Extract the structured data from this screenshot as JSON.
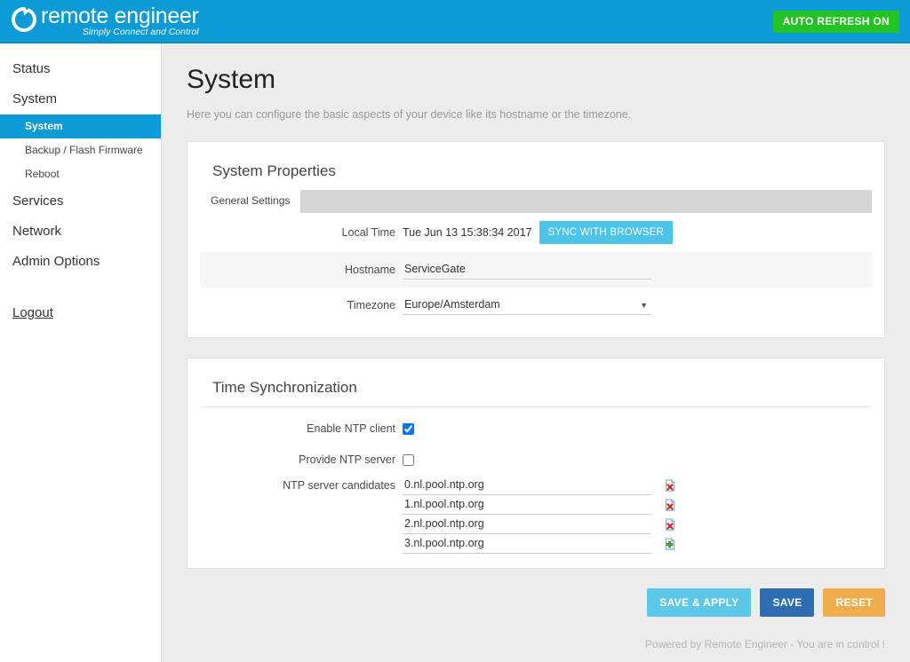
{
  "header": {
    "logo_title": "remote engineer",
    "logo_tagline": "Simply Connect and Control",
    "auto_refresh_label": "AUTO REFRESH ON",
    "bg_color": "#0c9bd4",
    "auto_refresh_color": "#22c322"
  },
  "sidebar": {
    "items": [
      {
        "label": "Status"
      },
      {
        "label": "System"
      }
    ],
    "sub_items": [
      {
        "label": "System",
        "active": true
      },
      {
        "label": "Backup / Flash Firmware",
        "active": false
      },
      {
        "label": "Reboot",
        "active": false
      }
    ],
    "items_after": [
      {
        "label": "Services"
      },
      {
        "label": "Network"
      },
      {
        "label": "Admin Options"
      }
    ],
    "logout_label": "Logout",
    "active_color": "#0c9bd4"
  },
  "main": {
    "page_title": "System",
    "page_desc": "Here you can configure the basic aspects of your device like its hostname or the timezone."
  },
  "system_properties": {
    "title": "System Properties",
    "tabs": [
      {
        "label": "General Settings",
        "active": true
      }
    ],
    "rows": {
      "local_time": {
        "label": "Local Time",
        "value": "Tue Jun 13 15:38:34 2017",
        "sync_button": "SYNC WITH BROWSER"
      },
      "hostname": {
        "label": "Hostname",
        "value": "ServiceGate"
      },
      "timezone": {
        "label": "Timezone",
        "value": "Europe/Amsterdam"
      }
    }
  },
  "time_sync": {
    "title": "Time Synchronization",
    "enable_ntp_client": {
      "label": "Enable NTP client",
      "checked": true
    },
    "provide_ntp_server": {
      "label": "Provide NTP server",
      "checked": false
    },
    "candidates_label": "NTP server candidates",
    "candidates": [
      {
        "value": "0.nl.pool.ntp.org",
        "action": "remove-icon"
      },
      {
        "value": "1.nl.pool.ntp.org",
        "action": "remove-icon"
      },
      {
        "value": "2.nl.pool.ntp.org",
        "action": "remove-icon"
      },
      {
        "value": "3.nl.pool.ntp.org",
        "action": "add-icon"
      }
    ]
  },
  "actions": {
    "save_apply_label": "SAVE & APPLY",
    "save_label": "SAVE",
    "reset_label": "RESET",
    "save_apply_color": "#5bc8e8",
    "save_color": "#2f6cb3",
    "reset_color": "#f0ad4e"
  },
  "footer": {
    "text": "Powered by Remote Engineer - You are in control !"
  }
}
